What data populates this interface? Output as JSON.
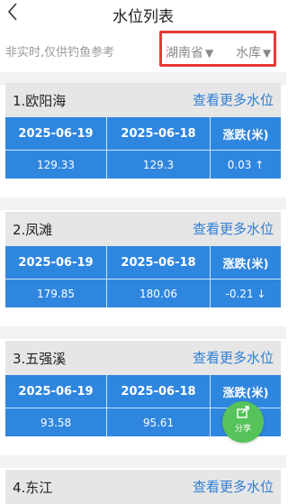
{
  "header": {
    "back_icon": "chevron-left-icon",
    "title": "水位列表"
  },
  "filter": {
    "notice": "非实时,仅供钓鱼参考",
    "province": "湖南省",
    "province_arrow": "▼",
    "type": "水库",
    "type_arrow": "▼"
  },
  "table_headers": {
    "date1": "2025-06-19",
    "date2": "2025-06-18",
    "change": "涨跌(米)"
  },
  "cards": [
    {
      "title": "1.欧阳海",
      "more": "查看更多水位",
      "v1": "129.33",
      "v2": "129.3",
      "change": "0.03 ↑"
    },
    {
      "title": "2.凤滩",
      "more": "查看更多水位",
      "v1": "179.85",
      "v2": "180.06",
      "change": "-0.21 ↓"
    },
    {
      "title": "3.五强溪",
      "more": "查看更多水位",
      "v1": "93.58",
      "v2": "95.61",
      "change": "-"
    },
    {
      "title": "4.东江",
      "more": "查看更多水位"
    }
  ],
  "share": {
    "icon": "share-icon",
    "label": "分享"
  },
  "colors": {
    "table_blue": "#2f86df",
    "link_blue": "#2f7fd5",
    "highlight_red": "#e53935",
    "share_green": "#55c35a"
  }
}
